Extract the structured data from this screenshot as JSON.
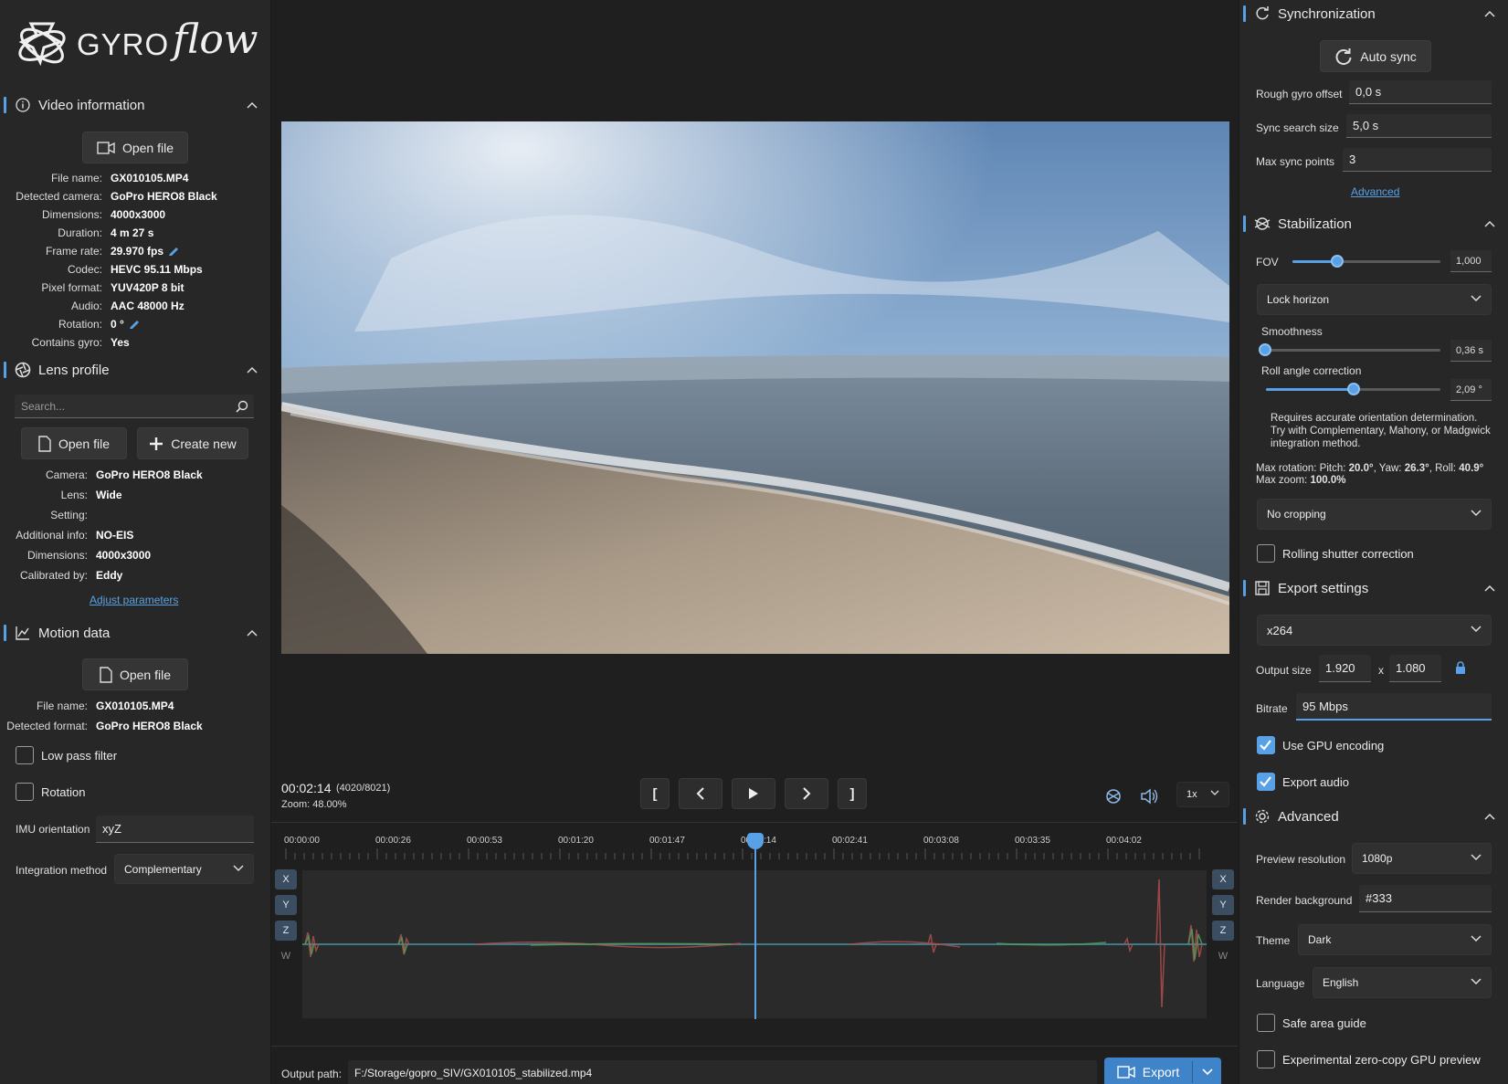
{
  "app": {
    "logo_text": "GYRO",
    "logo_script": "flow"
  },
  "video_info": {
    "title": "Video information",
    "open_file": "Open file",
    "rows": [
      {
        "k": "File name:",
        "v": "GX010105.MP4"
      },
      {
        "k": "Detected camera:",
        "v": "GoPro HERO8 Black"
      },
      {
        "k": "Dimensions:",
        "v": "4000x3000"
      },
      {
        "k": "Duration:",
        "v": "4 m 27 s"
      },
      {
        "k": "Frame rate:",
        "v": "29.970 fps"
      },
      {
        "k": "Codec:",
        "v": "HEVC 95.11 Mbps"
      },
      {
        "k": "Pixel format:",
        "v": "YUV420P 8 bit"
      },
      {
        "k": "Audio:",
        "v": "AAC 48000 Hz"
      },
      {
        "k": "Rotation:",
        "v": "0 °"
      },
      {
        "k": "Contains gyro:",
        "v": "Yes"
      }
    ]
  },
  "lens_profile": {
    "title": "Lens profile",
    "search_placeholder": "Search...",
    "open_file": "Open file",
    "create_new": "Create new",
    "rows": [
      {
        "k": "Camera:",
        "v": "GoPro HERO8 Black"
      },
      {
        "k": "Lens:",
        "v": "Wide"
      },
      {
        "k": "Setting:",
        "v": ""
      },
      {
        "k": "Additional info:",
        "v": "NO-EIS"
      },
      {
        "k": "Dimensions:",
        "v": "4000x3000"
      },
      {
        "k": "Calibrated by:",
        "v": "Eddy"
      }
    ],
    "adjust": "Adjust parameters"
  },
  "motion_data": {
    "title": "Motion data",
    "open_file": "Open file",
    "rows": [
      {
        "k": "File name:",
        "v": "GX010105.MP4"
      },
      {
        "k": "Detected format:",
        "v": "GoPro HERO8 Black"
      }
    ],
    "low_pass": "Low pass filter",
    "rotation": "Rotation",
    "imu_label": "IMU orientation",
    "imu_value": "xyZ",
    "integration_label": "Integration method",
    "integration_value": "Complementary"
  },
  "player": {
    "time": "00:02:14",
    "frame": "(4020/8021)",
    "zoom": "Zoom: 48.00%",
    "speed": "1x",
    "prev_mark": "[",
    "next_mark": "]",
    "progress": 0.501
  },
  "timeline": {
    "ticks": [
      "00:00:00",
      "00:00:26",
      "00:00:53",
      "00:01:20",
      "00:01:47",
      "00:02:14",
      "00:02:41",
      "00:03:08",
      "00:03:35",
      "00:04:02"
    ],
    "axes": [
      "X",
      "Y",
      "Z",
      "W"
    ]
  },
  "export_bar": {
    "label": "Output path:",
    "path": "F:/Storage/gopro_SIV/GX010105_stabilized.mp4",
    "button": "Export"
  },
  "sync": {
    "title": "Synchronization",
    "auto_sync": "Auto sync",
    "rough_label": "Rough gyro offset",
    "rough_value": "0,0 s",
    "search_label": "Sync search size",
    "search_value": "5,0 s",
    "points_label": "Max sync points",
    "points_value": "3",
    "advanced": "Advanced"
  },
  "stabilization": {
    "title": "Stabilization",
    "fov_label": "FOV",
    "fov_value": "1,000",
    "fov_level": 0.3,
    "method": "Lock horizon",
    "smooth_label": "Smoothness",
    "smooth_value": "0,36 s",
    "smooth_level": 0.02,
    "roll_label": "Roll angle correction",
    "roll_value": "2,09 °",
    "roll_level": 0.5,
    "note": "Requires accurate orientation determination. Try with Complementary, Mahony, or Madgwick integration method.",
    "max_rot_prefix": "Max rotation: Pitch: ",
    "pitch": "20.0°",
    "yaw_prefix": ", Yaw: ",
    "yaw": "26.3°",
    "roll_prefix": ", Roll: ",
    "roll": "40.9°",
    "max_zoom_prefix": "Max zoom: ",
    "max_zoom": "100.0%",
    "cropping": "No cropping",
    "rolling": "Rolling shutter correction"
  },
  "export_settings": {
    "title": "Export settings",
    "codec": "x264",
    "size_label": "Output size",
    "width": "1.920",
    "x": "x",
    "height": "1.080",
    "bitrate_label": "Bitrate",
    "bitrate": "95 Mbps",
    "gpu": "Use GPU encoding",
    "audio": "Export audio"
  },
  "advanced": {
    "title": "Advanced",
    "preview_label": "Preview resolution",
    "preview_value": "1080p",
    "bg_label": "Render background",
    "bg_value": "#333",
    "theme_label": "Theme",
    "theme_value": "Dark",
    "lang_label": "Language",
    "lang_value": "English",
    "safe_area": "Safe area guide",
    "zero_copy": "Experimental zero-copy GPU preview"
  },
  "colors": {
    "accent": "#59a1e6",
    "panel": "#272727",
    "bg": "#1e1e1e"
  }
}
